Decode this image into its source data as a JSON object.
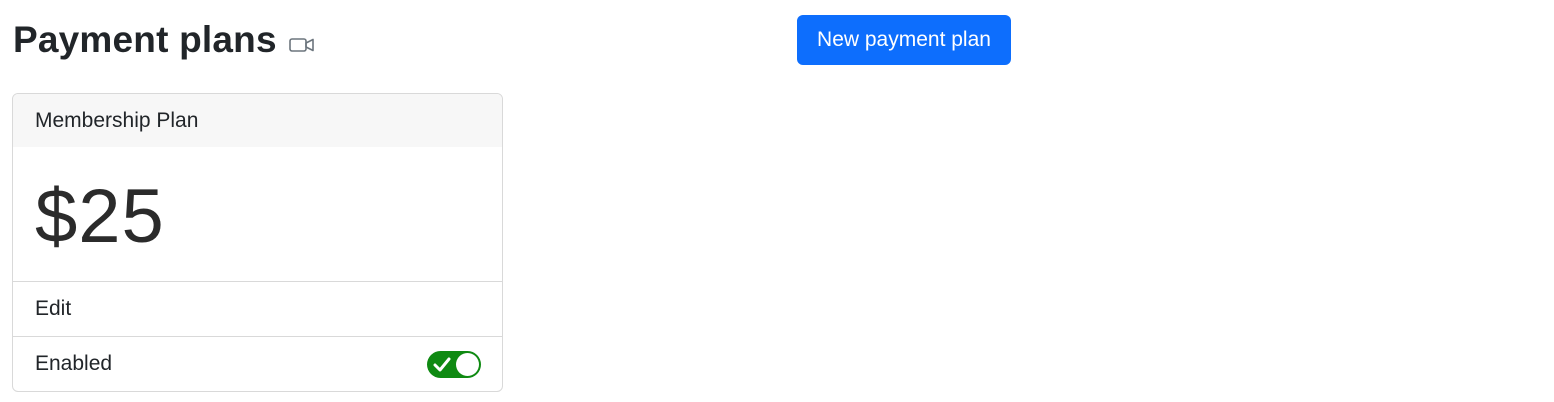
{
  "header": {
    "title": "Payment plans",
    "video_icon": "video-camera-icon",
    "new_button_label": "New payment plan"
  },
  "colors": {
    "primary": "#0d6efd",
    "toggle_on": "#0f8a12"
  },
  "plan": {
    "name": "Membership Plan",
    "price": "$25",
    "edit_label": "Edit",
    "enabled_label": "Enabled",
    "enabled": true
  }
}
